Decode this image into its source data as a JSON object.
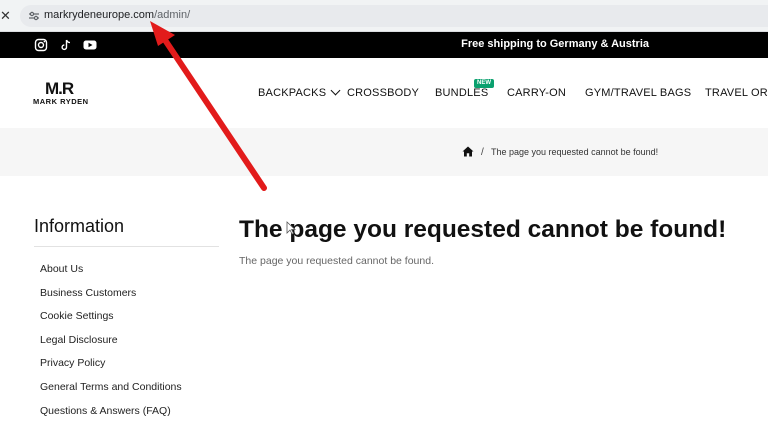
{
  "browser": {
    "close_glyph": "✕",
    "url_domain": "markrydeneurope.com",
    "url_path": "/admin/"
  },
  "topbar": {
    "shipping_text": "Free shipping to Germany & Austria",
    "social_icons": [
      "instagram-icon",
      "tiktok-icon",
      "youtube-icon"
    ]
  },
  "header": {
    "logo_mark": "M.R",
    "logo_text": "MARK RYDEN",
    "nav": [
      {
        "label": "BACKPACKS"
      },
      {
        "label": "CROSSBODY"
      },
      {
        "label": "BUNDLES",
        "badge": "NEW"
      },
      {
        "label": "CARRY-ON"
      },
      {
        "label": "GYM/TRAVEL BAGS"
      },
      {
        "label": "TRAVEL ORGA"
      }
    ]
  },
  "breadcrumb": {
    "separator": "/",
    "current": "The page you requested cannot be found!"
  },
  "sidebar": {
    "title": "Information",
    "links": [
      "About Us",
      "Business Customers",
      "Cookie Settings",
      "Legal Disclosure",
      "Privacy Policy",
      "General Terms and Conditions",
      "Questions & Answers (FAQ)"
    ]
  },
  "main": {
    "title": "The page you requested cannot be found!",
    "message": "The page you requested cannot be found."
  },
  "colors": {
    "topbar_bg": "#000000",
    "badge_green": "#0aa06e",
    "annotation_arrow": "#e21b1b",
    "crumb_bg": "#f6f6f6"
  }
}
